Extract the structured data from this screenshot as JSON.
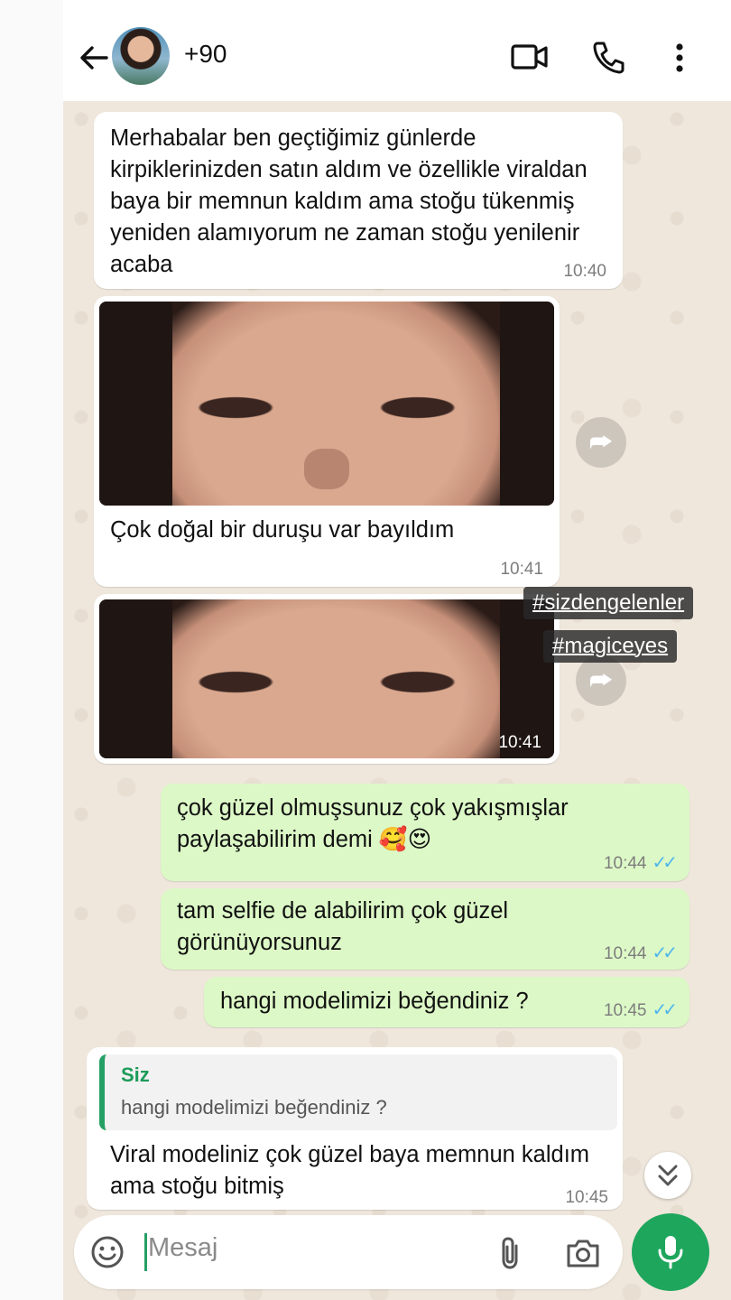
{
  "header": {
    "contact_name": "+90",
    "icons": [
      "back-arrow-icon",
      "avatar",
      "video-call-icon",
      "phone-call-icon",
      "more-vert-icon"
    ]
  },
  "messages": [
    {
      "type": "incoming",
      "text": "Merhabalar ben geçtiğimiz günlerde kirpiklerinizden satın aldım ve özellikle viraldan baya bir memnun kaldım ama stoğu tükenmiş yeniden alamıyorum ne zaman stoğu yenilenir acaba",
      "time": "10:40"
    },
    {
      "type": "incoming-image",
      "caption": "Çok doğal bir duruşu var bayıldım",
      "time": "10:41"
    },
    {
      "type": "incoming-image",
      "time": "10:41"
    },
    {
      "type": "outgoing",
      "text": "çok güzel olmuşsunuz çok yakışmışlar paylaşabilirim demi 🥰😍",
      "time": "10:44",
      "ticks": "✓✓"
    },
    {
      "type": "outgoing",
      "text": "tam selfie de alabilirim çok güzel görünüyorsunuz",
      "time": "10:44",
      "ticks": "✓✓"
    },
    {
      "type": "outgoing",
      "text": "hangi modelimizi beğendiniz ?",
      "time": "10:45",
      "ticks": "✓✓"
    },
    {
      "type": "incoming-reply",
      "quote_name": "Siz",
      "quote_text": "hangi modelimizi beğendiniz ?",
      "text": "Viral modeliniz çok güzel baya memnun kaldım ama stoğu bitmiş",
      "time": "10:45"
    }
  ],
  "overlay_tags": [
    "#sizdengelenler",
    "#magiceyes"
  ],
  "input": {
    "placeholder": "Mesaj"
  },
  "colors": {
    "outgoing_bubble": "#dcf8c6",
    "incoming_bubble": "#ffffff",
    "accent": "#1ea65c",
    "tick": "#4fb6ec",
    "chat_bg": "#efe7dc"
  }
}
